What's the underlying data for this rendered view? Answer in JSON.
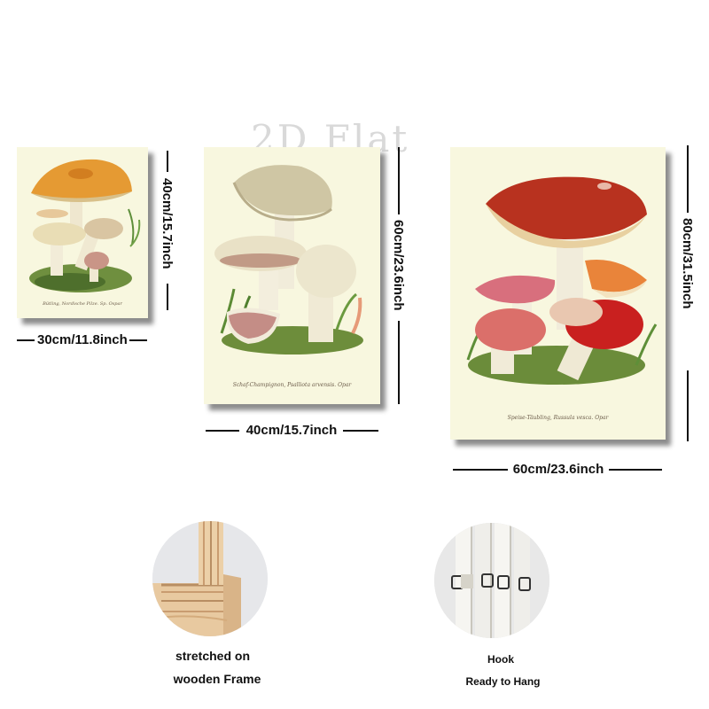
{
  "watermark": "2D Flat",
  "panels": [
    {
      "caption": "Bütling, Nordische Pilze. Sp. Ospar",
      "width_label": "30cm/11.8inch",
      "height_label": "40cm/15.7inch"
    },
    {
      "caption": "Schaf-Champignon, Psalliota arvensis. Opar",
      "width_label": "40cm/15.7inch",
      "height_label": "60cm/23.6inch"
    },
    {
      "caption": "Speise-Täubling, Russula vesca. Opar",
      "width_label": "60cm/23.6inch",
      "height_label": "80cm/31.5inch"
    }
  ],
  "features": [
    {
      "line1": "stretched on",
      "line2": "wooden Frame"
    },
    {
      "line1": "Hook",
      "line2": "Ready to Hang"
    }
  ]
}
